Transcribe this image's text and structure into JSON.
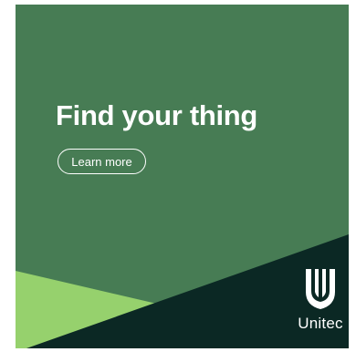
{
  "ad": {
    "headline": "Find your thing",
    "cta_label": "Learn more",
    "brand": "Unitec",
    "icon": "unitec-shield-logo",
    "colors": {
      "background": "#477c54",
      "dark_panel": "#0b2824",
      "light_triangle": "#96d16d",
      "text": "#ffffff"
    }
  }
}
